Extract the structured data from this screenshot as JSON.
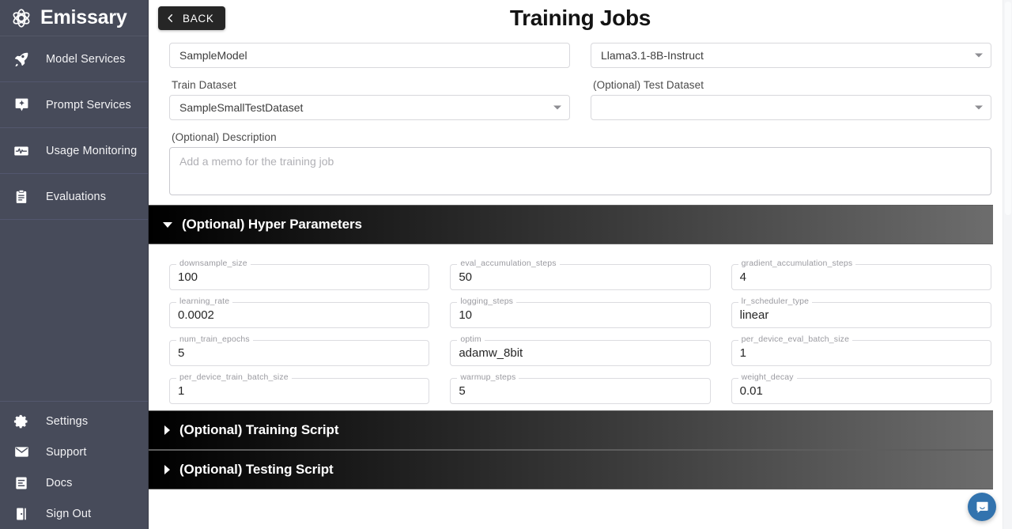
{
  "brand": {
    "name": "Emissary",
    "logo_icon": "atom-logo-icon"
  },
  "sidebar": {
    "items": [
      {
        "label": "Model Services",
        "icon": "rocket-icon"
      },
      {
        "label": "Prompt Services",
        "icon": "prompt-sparkle-icon"
      },
      {
        "label": "Usage Monitoring",
        "icon": "activity-monitor-icon"
      },
      {
        "label": "Evaluations",
        "icon": "clipboard-icon"
      }
    ],
    "bottom_items": [
      {
        "label": "Settings",
        "icon": "gear-icon"
      },
      {
        "label": "Support",
        "icon": "envelope-icon"
      },
      {
        "label": "Docs",
        "icon": "document-icon"
      },
      {
        "label": "Sign Out",
        "icon": "sign-out-icon"
      }
    ]
  },
  "header": {
    "back_label": "BACK",
    "back_icon": "chevron-left-icon",
    "title": "Training Jobs"
  },
  "form": {
    "model_name": {
      "label": "",
      "value": "SampleModel"
    },
    "base_model": {
      "label": "",
      "value": "Llama3.1-8B-Instruct"
    },
    "train_dataset": {
      "label": "Train Dataset",
      "value": "SampleSmallTestDataset"
    },
    "test_dataset": {
      "label": "(Optional) Test Dataset",
      "value": ""
    },
    "description": {
      "label": "(Optional) Description",
      "value": "",
      "placeholder": "Add a memo for the training job"
    }
  },
  "sections": {
    "hyper_parameters": {
      "title": "(Optional) Hyper Parameters",
      "expanded": true,
      "toggle_icon": "triangle-down-icon"
    },
    "training_script": {
      "title": "(Optional) Training Script",
      "expanded": false,
      "toggle_icon": "triangle-right-icon"
    },
    "testing_script": {
      "title": "(Optional) Testing Script",
      "expanded": false,
      "toggle_icon": "triangle-right-icon"
    }
  },
  "hyper_parameters": [
    {
      "label": "downsample_size",
      "value": "100"
    },
    {
      "label": "eval_accumulation_steps",
      "value": "50"
    },
    {
      "label": "gradient_accumulation_steps",
      "value": "4"
    },
    {
      "label": "learning_rate",
      "value": "0.0002"
    },
    {
      "label": "logging_steps",
      "value": "10"
    },
    {
      "label": "lr_scheduler_type",
      "value": "linear"
    },
    {
      "label": "num_train_epochs",
      "value": "5"
    },
    {
      "label": "optim",
      "value": "adamw_8bit"
    },
    {
      "label": "per_device_eval_batch_size",
      "value": "1"
    },
    {
      "label": "per_device_train_batch_size",
      "value": "1"
    },
    {
      "label": "warmup_steps",
      "value": "5"
    },
    {
      "label": "weight_decay",
      "value": "0.01"
    }
  ],
  "chat_launcher": {
    "icon": "chat-bubble-icon",
    "color": "#3273ae"
  },
  "colors": {
    "sidebar_bg": "#474b5a",
    "accent_dark": "#262626",
    "chat_blue": "#3273ae"
  }
}
